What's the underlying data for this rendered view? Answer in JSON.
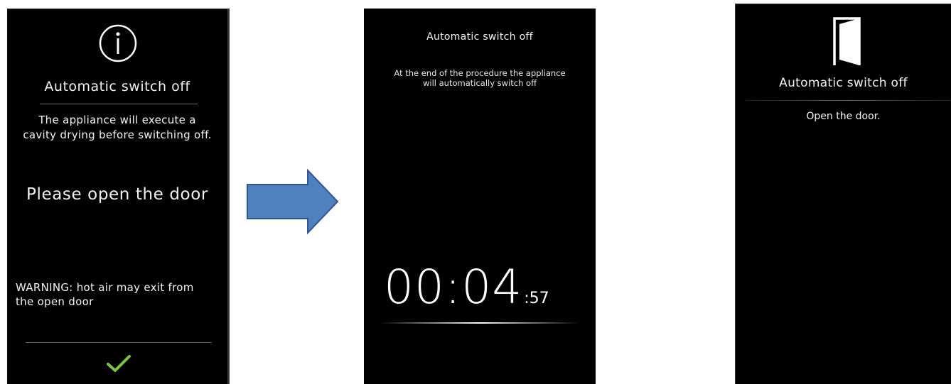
{
  "screen1": {
    "icon": "info-icon",
    "title": "Automatic switch off",
    "body_line1": "The appliance will execute a",
    "body_line2": "cavity drying before switching off.",
    "prompt": "Please open the door",
    "warning_line1": "WARNING:  hot air may exit from",
    "warning_line2": "the open door",
    "confirm_icon": "checkmark-icon",
    "confirm_color": "#7dc242"
  },
  "arrow": {
    "icon": "right-arrow-icon",
    "fill": "#4f81bd",
    "stroke": "#2f5597"
  },
  "screen2": {
    "title": "Automatic switch off",
    "body_line1": "At the end of the procedure the appliance",
    "body_line2": "will automatically switch off",
    "timer_main": "00:04",
    "timer_seconds": ":57"
  },
  "screen3": {
    "icon": "door-icon",
    "title": "Automatic switch off",
    "body": "Open the door."
  }
}
